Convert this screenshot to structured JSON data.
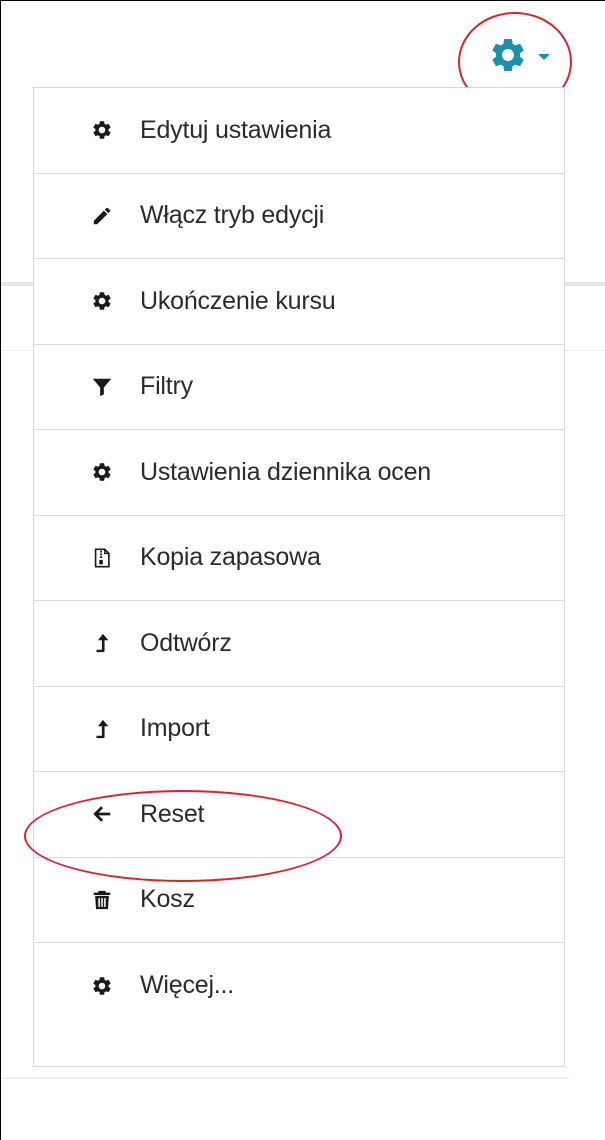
{
  "colors": {
    "gear_accent": "#1b8fb0",
    "icon": "#1a1a1a",
    "annotation": "#e0212a"
  },
  "trigger": {
    "icon": "gear-icon",
    "caret_icon": "caret-down-icon"
  },
  "menu": {
    "items": [
      {
        "label": "Edytuj ustawienia",
        "icon": "gear-icon"
      },
      {
        "label": "Włącz tryb edycji",
        "icon": "pencil-icon"
      },
      {
        "label": "Ukończenie kursu",
        "icon": "gear-icon"
      },
      {
        "label": "Filtry",
        "icon": "filter-icon"
      },
      {
        "label": "Ustawienia dziennika ocen",
        "icon": "gear-icon"
      },
      {
        "label": "Kopia zapasowa",
        "icon": "file-archive-icon"
      },
      {
        "label": "Odtwórz",
        "icon": "level-up-icon"
      },
      {
        "label": "Import",
        "icon": "level-up-icon"
      },
      {
        "label": "Reset",
        "icon": "arrow-left-icon"
      },
      {
        "label": "Kosz",
        "icon": "trash-icon"
      },
      {
        "label": "Więcej...",
        "icon": "gear-icon"
      }
    ]
  }
}
